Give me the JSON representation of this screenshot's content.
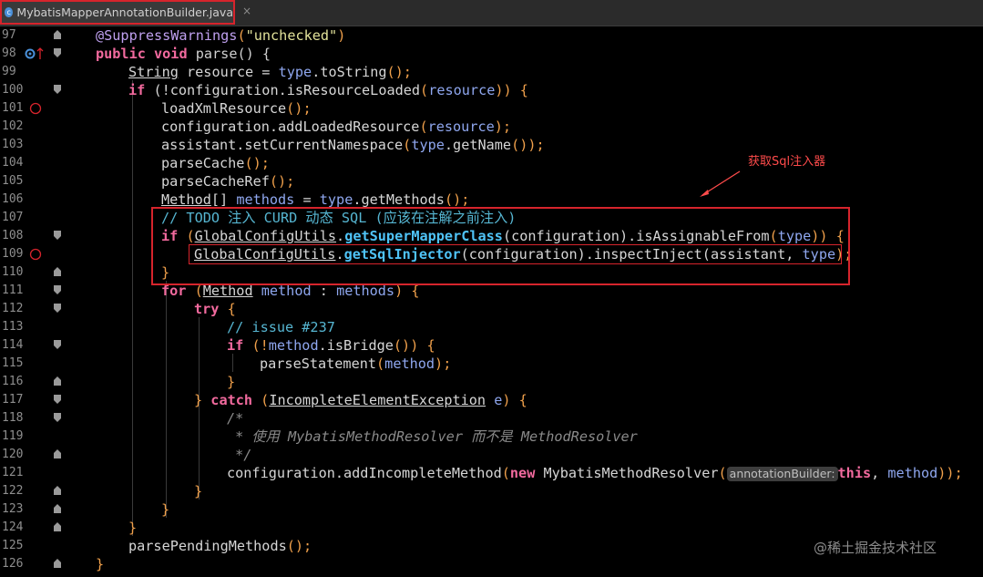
{
  "tab": {
    "icon": "c",
    "title": "MybatisMapperAnnotationBuilder.java",
    "close": "×"
  },
  "gutter": {
    "line_numbers": [
      "97",
      "98",
      "99",
      "100",
      "101",
      "102",
      "103",
      "104",
      "105",
      "106",
      "107",
      "108",
      "109",
      "110",
      "111",
      "112",
      "113",
      "114",
      "115",
      "116",
      "117",
      "118",
      "119",
      "120",
      "121",
      "122",
      "123",
      "124",
      "125",
      "126"
    ]
  },
  "code": {
    "l97": {
      "a1": "@SuppressWarnings",
      "a2": "(",
      "a3": "\"unchecked\"",
      "a4": ")"
    },
    "l98": {
      "a1": "public",
      "a2": " void ",
      "a3": "parse",
      "a4": "() {"
    },
    "l99": {
      "a1": "String",
      "a2": " resource = ",
      "a3": "type",
      "a4": ".toString",
      "a5": "();"
    },
    "l100": {
      "a1": "if",
      "a2": " (!configuration.isResourceLoaded",
      "a3": "(",
      "a4": "resource",
      "a5": ")) {"
    },
    "l101": {
      "a1": "loadXmlResource",
      "a2": "();"
    },
    "l102": {
      "a1": "configuration.addLoadedResource",
      "a2": "(",
      "a3": "resource",
      "a4": ");"
    },
    "l103": {
      "a1": "assistant.setCurrentNamespace",
      "a2": "(",
      "a3": "type",
      "a4": ".getName",
      "a5": "());"
    },
    "l104": {
      "a1": "parseCache",
      "a2": "();"
    },
    "l105": {
      "a1": "parseCacheRef",
      "a2": "();"
    },
    "l106": {
      "a1": "Method",
      "a2": "[] ",
      "a3": "methods",
      "a4": " = ",
      "a5": "type",
      "a6": ".getMethods",
      "a7": "();"
    },
    "l107": {
      "a1": "// TODO 注入 CURD 动态 SQL (应该在注解之前注入)"
    },
    "l108": {
      "a1": "if",
      "a2": " (",
      "a3": "GlobalConfigUtils",
      "a4": ".",
      "a5": "getSuperMapperClass",
      "a6": "(configuration)",
      "a7": ".isAssignableFrom",
      "a8": "(",
      "a9": "type",
      "a10": ")) {"
    },
    "l109": {
      "a1": "GlobalConfigUtils",
      "a2": ".",
      "a3": "getSqlInjector",
      "a4": "(configuration)",
      "a5": ".inspectInject",
      "a6": "(assistant, ",
      "a7": "type",
      "a8": ");"
    },
    "l110": {
      "a1": "}"
    },
    "l111": {
      "a1": "for",
      "a2": " (",
      "a3": "Method",
      "a4": " method",
      "a5": " : ",
      "a6": "methods",
      "a7": ") {"
    },
    "l112": {
      "a1": "try",
      "a2": " {"
    },
    "l113": {
      "a1": "// issue #237"
    },
    "l114": {
      "a1": "if",
      "a2": " (!",
      "a3": "method",
      "a4": ".isBridge",
      "a5": "()) {"
    },
    "l115": {
      "a1": "parseStatement",
      "a2": "(",
      "a3": "method",
      "a4": ");"
    },
    "l116": {
      "a1": "}"
    },
    "l117": {
      "a1": "}",
      "a2": " catch",
      "a3": " (",
      "a4": "IncompleteElementException",
      "a5": " e",
      "a6": ") {"
    },
    "l118": {
      "a1": "/*"
    },
    "l119": {
      "a1": " * 使用 MybatisMethodResolver 而不是 MethodResolver"
    },
    "l120": {
      "a1": " */"
    },
    "l121": {
      "a1": "configuration.addIncompleteMethod",
      "a2": "(",
      "a3": "new",
      "a4": " MybatisMethodResolver",
      "a5": "(",
      "a6": "annotationBuilder:",
      "a7": "this",
      "a8": ", ",
      "a9": "method",
      "a10": "));"
    },
    "l122": {
      "a1": "}"
    },
    "l123": {
      "a1": "}"
    },
    "l124": {
      "a1": "}"
    },
    "l125": {
      "a1": "parsePendingMethods",
      "a2": "();"
    },
    "l126": {
      "a1": "}"
    }
  },
  "annotation": {
    "label": "获取Sql注入器"
  },
  "watermark": "@稀土掘金技术社区",
  "colors": {
    "highlight_box": "#d6242c",
    "background": "#000000"
  }
}
